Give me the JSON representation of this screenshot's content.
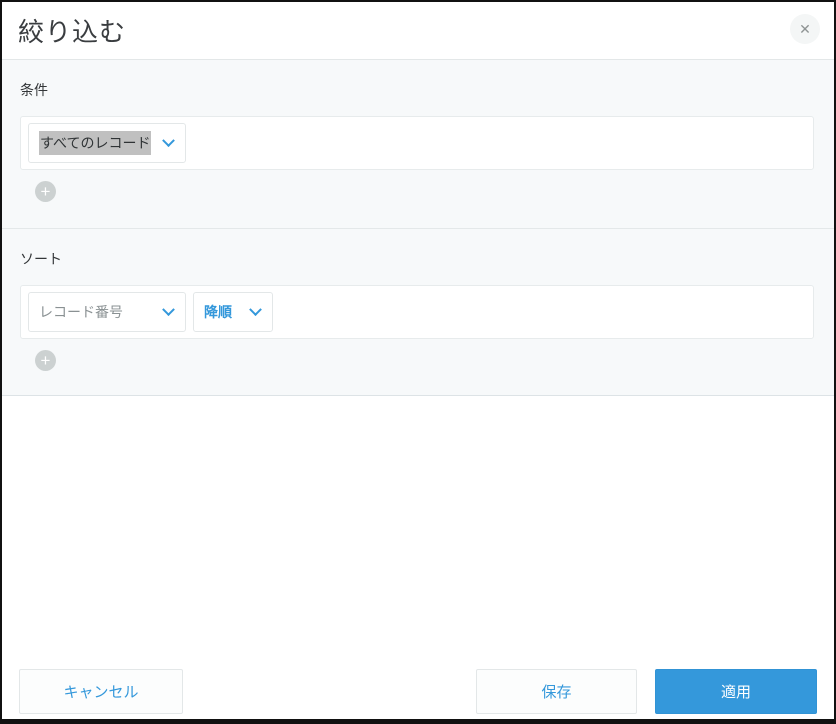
{
  "dialog": {
    "title": "絞り込む",
    "close_icon": "✕"
  },
  "conditions_section": {
    "label": "条件",
    "scope_dropdown": {
      "value": "すべてのレコード",
      "text_selected": true
    },
    "add_icon": "+"
  },
  "sort_section": {
    "label": "ソート",
    "field_dropdown": {
      "value": "レコード番号"
    },
    "order_dropdown": {
      "value": "降順"
    },
    "add_icon": "+"
  },
  "footer": {
    "cancel_label": "キャンセル",
    "save_label": "保存",
    "apply_label": "適用"
  },
  "colors": {
    "accent_blue": "#3498db",
    "section_bg": "#f7f9fa",
    "border": "#e3e7e8",
    "selection_highlight": "#c0c0c0",
    "apply_bg": "#3498db"
  }
}
